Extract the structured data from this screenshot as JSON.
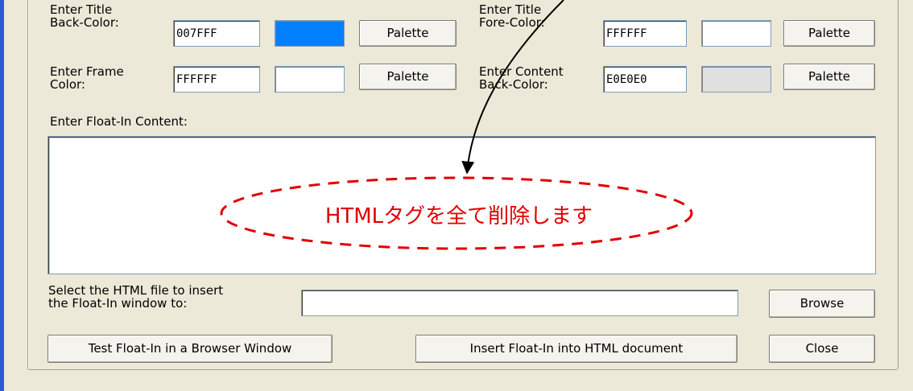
{
  "colors": {
    "title_back": "#007FFF",
    "title_fore": "#FFFFFF",
    "frame": "#FFFFFF",
    "content_back": "#E0E0E0",
    "annotation": "#E00000"
  },
  "title_back": {
    "label_line1": "Enter Title",
    "label_line2": "Back-Color:",
    "value": "007FFF",
    "button": "Palette"
  },
  "title_fore": {
    "label_line1": "Enter Title",
    "label_line2": "Fore-Color:",
    "value": "FFFFFF",
    "button": "Palette"
  },
  "frame_color": {
    "label_line1": "Enter Frame",
    "label_line2": "Color:",
    "value": "FFFFFF",
    "button": "Palette"
  },
  "content_back": {
    "label_line1": "Enter Content",
    "label_line2": "Back-Color:",
    "value": "E0E0E0",
    "button": "Palette"
  },
  "content": {
    "label": "Enter Float-In Content:",
    "value": ""
  },
  "file": {
    "label_line1": "Select the HTML file to insert",
    "label_line2": "the Float-In window to:",
    "value": "",
    "browse": "Browse"
  },
  "actions": {
    "test": "Test Float-In in a Browser Window",
    "insert": "Insert Float-In into HTML document",
    "close": "Close"
  },
  "annotation": {
    "text": "HTMLタグを全て削除します"
  }
}
